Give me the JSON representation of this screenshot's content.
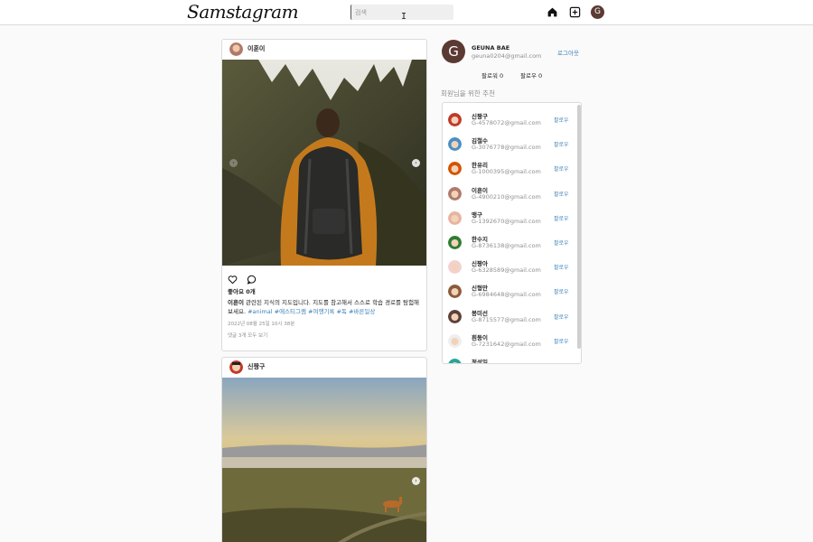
{
  "app": {
    "logo": "Samstagram"
  },
  "search": {
    "placeholder": "검색"
  },
  "nav": {
    "profile_initial": "G"
  },
  "posts": [
    {
      "user": "이훈이",
      "likes": "좋아요 0개",
      "caption_user": "이훈이",
      "caption_text": " 관련된 지식의 지도입니다. 지도를 참고해서 스스로 학습 경로를 탐험해보세요. ",
      "tags": "#animal #에스티그램 #여행기록 #독 #바른일상",
      "date": "2022년 08월 25일 10시 38분",
      "comments": "댓글 3개 모두 보기"
    },
    {
      "user": "신짱구"
    }
  ],
  "profile": {
    "initial": "G",
    "name": "GEUNA BAE",
    "email": "geuna0204@gmail.com",
    "logout": "로그아웃",
    "followers": "팔로워 0",
    "following": "팔로우 0"
  },
  "recommend": {
    "title": "회원님을 위한 추천",
    "follow_label": "팔로우",
    "users": [
      {
        "name": "신짱구",
        "email": "G-4578072@gmail.com",
        "color": "#c0392b"
      },
      {
        "name": "김철수",
        "email": "G-3076778@gmail.com",
        "color": "#4a8fc7"
      },
      {
        "name": "한유리",
        "email": "G-1000395@gmail.com",
        "color": "#d35400"
      },
      {
        "name": "이훈이",
        "email": "G-4900210@gmail.com",
        "color": "#b07a6a"
      },
      {
        "name": "맹구",
        "email": "G-1392670@gmail.com",
        "color": "#e8b4a0"
      },
      {
        "name": "한수지",
        "email": "G-8736138@gmail.com",
        "color": "#2e7d32"
      },
      {
        "name": "신짱아",
        "email": "G-6328589@gmail.com",
        "color": "#f3d1d1"
      },
      {
        "name": "신형만",
        "email": "G-6984648@gmail.com",
        "color": "#8d5a3b"
      },
      {
        "name": "봉미선",
        "email": "G-8715577@gmail.com",
        "color": "#5d4037"
      },
      {
        "name": "흰둥이",
        "email": "G-7231642@gmail.com",
        "color": "#eeeeee"
      },
      {
        "name": "정성일",
        "email": "",
        "color": "#26a69a"
      }
    ]
  }
}
